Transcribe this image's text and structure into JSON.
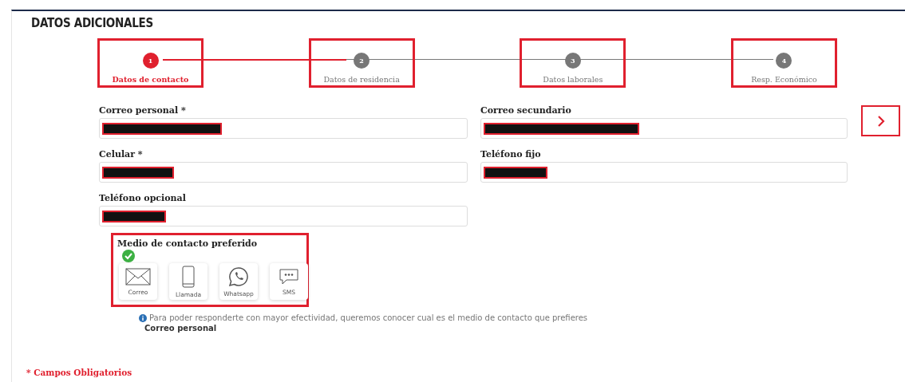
{
  "section_title": "DATOS ADICIONALES",
  "steps": [
    {
      "number": "1",
      "label": "Datos de contacto",
      "selected": true,
      "outlined": true
    },
    {
      "number": "2",
      "label": "Datos de residencia",
      "selected": false,
      "outlined": true
    },
    {
      "number": "3",
      "label": "Datos laborales",
      "selected": false,
      "outlined": true
    },
    {
      "number": "4",
      "label": "Resp. Económico",
      "selected": false,
      "outlined": true
    }
  ],
  "fields": [
    {
      "label": "Correo personal *",
      "redacted": true
    },
    {
      "label": "Correo secundario",
      "redacted": true
    },
    {
      "label": "Celular *",
      "redacted": true
    },
    {
      "label": "Teléfono fijo",
      "redacted": true
    },
    {
      "label": "Teléfono opcional",
      "redacted": true
    }
  ],
  "contact_preference": {
    "title": "Medio de contacto preferido",
    "outlined": true,
    "options": [
      {
        "kind": "mail",
        "label": "Correo",
        "selected": true
      },
      {
        "kind": "phone",
        "label": "Llamada",
        "selected": false
      },
      {
        "kind": "whatsapp",
        "label": "Whatsapp",
        "selected": false
      },
      {
        "kind": "sms",
        "label": "SMS",
        "selected": false
      }
    ],
    "info": "Para poder responderte con mayor efectividad, queremos conocer cual es el medio de contacto que prefieres",
    "chosen": "Correo personal"
  },
  "required_note": "* Campos Obligatorios"
}
